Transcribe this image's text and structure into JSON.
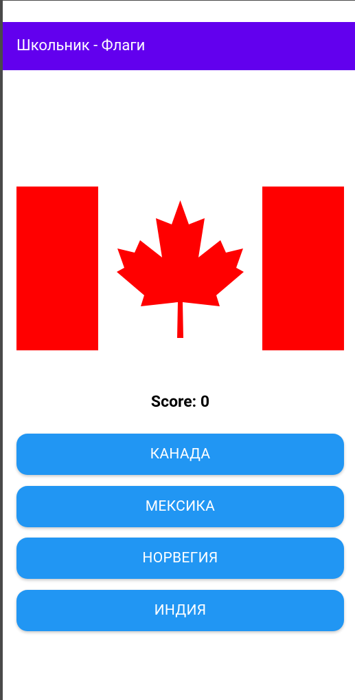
{
  "app_bar": {
    "title": "Школьник - Флаги"
  },
  "flag": {
    "icon": "canada-flag",
    "colors": {
      "red": "#ff0000",
      "white": "#ffffff"
    }
  },
  "score": {
    "text": "Score: 0"
  },
  "answers": [
    {
      "label": "КАНАДА"
    },
    {
      "label": "МЕКСИКА"
    },
    {
      "label": "НОРВЕГИЯ"
    },
    {
      "label": "ИНДИЯ"
    }
  ],
  "colors": {
    "app_bar": "#6200ee",
    "button": "#2196f3",
    "button_text": "#ffffff"
  }
}
